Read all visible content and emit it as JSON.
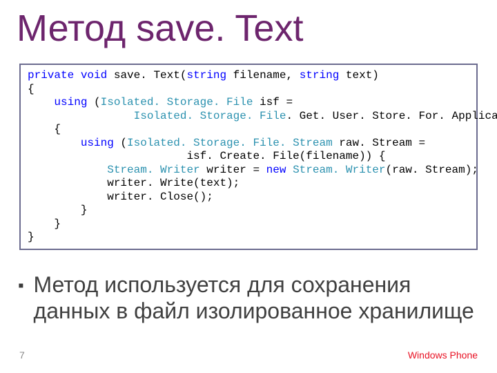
{
  "title": "Метод save. Text",
  "code": {
    "lines": [
      [
        {
          "t": "private",
          "c": "kw-blue"
        },
        {
          "t": " "
        },
        {
          "t": "void",
          "c": "kw-blue"
        },
        {
          "t": " save. Text("
        },
        {
          "t": "string",
          "c": "kw-blue"
        },
        {
          "t": " filename, "
        },
        {
          "t": "string",
          "c": "kw-blue"
        },
        {
          "t": " text)"
        }
      ],
      [
        {
          "t": "{"
        }
      ],
      [
        {
          "t": "    "
        },
        {
          "t": "using",
          "c": "kw-blue"
        },
        {
          "t": " ("
        },
        {
          "t": "Isolated. Storage. File",
          "c": "kw-teal"
        },
        {
          "t": " isf ="
        }
      ],
      [
        {
          "t": "                "
        },
        {
          "t": "Isolated. Storage. File",
          "c": "kw-teal"
        },
        {
          "t": ". Get. User. Store. For. Application())"
        }
      ],
      [
        {
          "t": "    {"
        }
      ],
      [
        {
          "t": "        "
        },
        {
          "t": "using",
          "c": "kw-blue"
        },
        {
          "t": " ("
        },
        {
          "t": "Isolated. Storage. File. Stream",
          "c": "kw-teal"
        },
        {
          "t": " raw. Stream ="
        }
      ],
      [
        {
          "t": "                        isf. Create. File(filename)) {"
        }
      ],
      [
        {
          "t": "            "
        },
        {
          "t": "Stream. Writer",
          "c": "kw-teal"
        },
        {
          "t": " writer = "
        },
        {
          "t": "new",
          "c": "kw-blue"
        },
        {
          "t": " "
        },
        {
          "t": "Stream. Writer",
          "c": "kw-teal"
        },
        {
          "t": "(raw. Stream);"
        }
      ],
      [
        {
          "t": "            writer. Write(text);"
        }
      ],
      [
        {
          "t": "            writer. Close();"
        }
      ],
      [
        {
          "t": "        }"
        }
      ],
      [
        {
          "t": "    }"
        }
      ],
      [
        {
          "t": "}"
        }
      ]
    ]
  },
  "bullet": {
    "marker": "▪",
    "text": "Метод используется для сохранения данных в файл изолированное хранилище"
  },
  "footer": {
    "page": "7",
    "brand": "Windows Phone"
  }
}
